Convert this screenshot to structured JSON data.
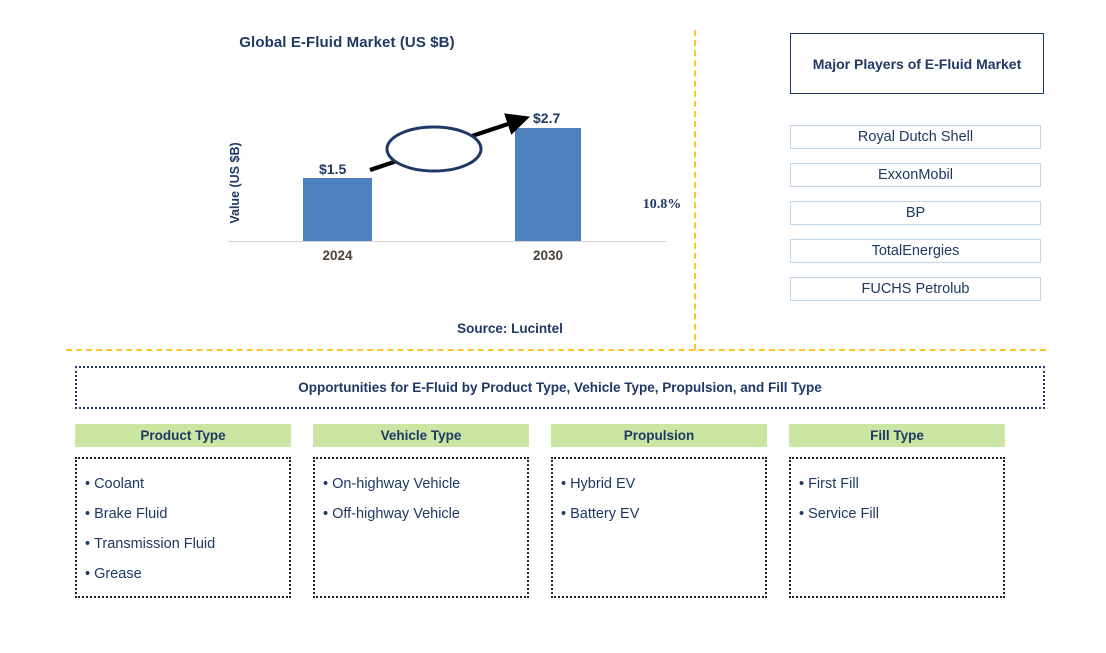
{
  "chart_data": {
    "type": "bar",
    "title": "Global E-Fluid Market (US $B)",
    "xlabel": "",
    "ylabel": "Value (US $B)",
    "categories": [
      "2024",
      "2030"
    ],
    "values": [
      1.5,
      2.7
    ],
    "value_labels": [
      "$1.5",
      "$2.7"
    ],
    "annotation": "10.8%",
    "annotation_note": "CAGR growth arrow from 2024 bar to 2030 bar",
    "series": [
      {
        "name": "Global E-Fluid Market",
        "values": [
          1.5,
          2.7
        ]
      }
    ],
    "ylim": [
      0,
      3.0
    ],
    "grid": false,
    "legend": "none",
    "bar_color": "#4E81BD",
    "source": "Source: Lucintel"
  },
  "chart": {
    "title": "Global E-Fluid Market (US $B)",
    "y_axis_label": "Value (US $B)",
    "bars": [
      {
        "year": "2024",
        "label": "$1.5"
      },
      {
        "year": "2030",
        "label": "$2.7"
      }
    ],
    "cagr": "10.8%",
    "source": "Source: Lucintel"
  },
  "players": {
    "header": "Major Players of E-Fluid Market",
    "items": [
      "Royal Dutch Shell",
      "ExxonMobil",
      "BP",
      "TotalEnergies",
      "FUCHS Petrolub"
    ]
  },
  "opportunities": {
    "banner": "Opportunities for E-Fluid by Product Type, Vehicle Type, Propulsion, and Fill Type",
    "columns": [
      {
        "header": "Product Type",
        "items": [
          "Coolant",
          "Brake Fluid",
          "Transmission Fluid",
          "Grease"
        ]
      },
      {
        "header": "Vehicle Type",
        "items": [
          "On-highway Vehicle",
          "Off-highway Vehicle"
        ]
      },
      {
        "header": "Propulsion",
        "items": [
          "Hybrid EV",
          "Battery EV"
        ]
      },
      {
        "header": "Fill Type",
        "items": [
          "First Fill",
          "Service Fill"
        ]
      }
    ]
  },
  "colors": {
    "navy": "#1F3864",
    "bar_blue": "#4E81BD",
    "divider_gold": "#FFC629",
    "header_green": "#CBE6A2",
    "player_border": "#BFD5EA"
  }
}
